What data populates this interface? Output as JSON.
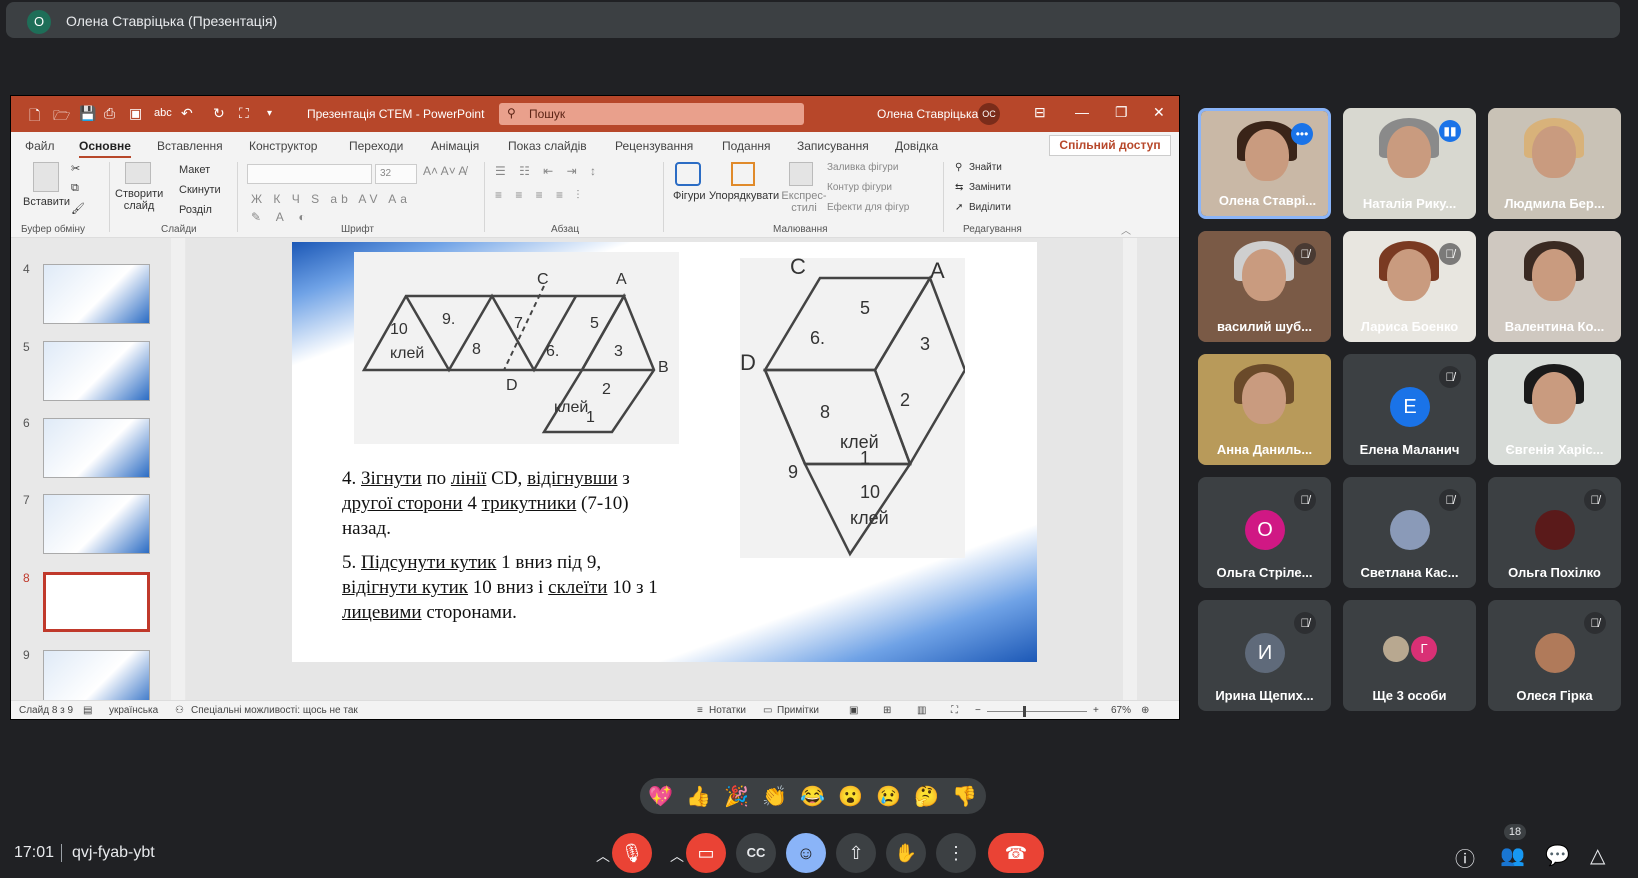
{
  "presenter": {
    "initial": "О",
    "title": "Олена Ставрiцька (Презентацiя)"
  },
  "ppt": {
    "doc_title": "Презентацiя СТЕМ  -  PowerPoint",
    "search_placeholder": "Пошук",
    "user_name": "Олена Ставрiцька",
    "user_initials": "ОС",
    "menu": [
      "Файл",
      "Основне",
      "Вставлення",
      "Конструктор",
      "Переходи",
      "Анiмацiя",
      "Показ слайдiв",
      "Рецензування",
      "Подання",
      "Записування",
      "Довiдка"
    ],
    "share": "Спiльний доступ",
    "ribbon": {
      "paste": "Вставити",
      "clipboard": "Буфер обмiну",
      "new_slide": "Створити слайд",
      "layout": "Макет",
      "reset": "Скинути",
      "section": "Роздiл",
      "slides": "Слайди",
      "font": "Шрифт",
      "font_size": "32",
      "paragraph": "Абзац",
      "shapes": "Фiгури",
      "arrange": "Упорядкувати",
      "quick_styles": "Експрес-стилi",
      "fill": "Заливка фiгури",
      "outline": "Контур фiгури",
      "effects": "Ефекти для фiгур",
      "drawing": "Малювання",
      "find": "Знайти",
      "replace": "Замiнити",
      "select": "Видiлити",
      "editing": "Редагування"
    },
    "thumb_numbers": [
      "4",
      "5",
      "6",
      "7",
      "8",
      "9"
    ],
    "slide": {
      "labels_left": [
        "10",
        "клей",
        "9.",
        "8",
        "7",
        "6.",
        "5",
        "3",
        "2",
        "клей",
        "1",
        "C",
        "A",
        "B",
        "D"
      ],
      "labels_right": [
        "C",
        "A",
        "D",
        "5",
        "6.",
        "3",
        "8",
        "2",
        "клей",
        "1",
        "9",
        "10",
        "клей"
      ],
      "step4": [
        "4. ",
        "Зiгнути",
        " по ",
        "лiнiї",
        " CD, ",
        "вiдiгнувши",
        " з",
        "другої сторони",
        " 4 ",
        "трикутники",
        " (7-10)",
        "назад."
      ],
      "step5": [
        "5. ",
        "Пiдсунути кутик",
        " 1 вниз пiд 9,",
        "вiдiгнути кутик",
        " 10 вниз i ",
        "склеїти",
        " 10 з 1",
        "лицевими",
        " сторонами."
      ]
    },
    "status": {
      "slide_of": "Слайд 8 з 9",
      "language": "українська",
      "accessibility": "Спецiальнi можливостi: щось не так",
      "notes": "Нотатки",
      "comments": "Примiтки",
      "zoom": "67%"
    }
  },
  "participants": [
    {
      "name": "Олена Ставрi...",
      "muted": false,
      "kind": "photo",
      "hair": "#3a2418",
      "bg": "#c9b8a6"
    },
    {
      "name": "Наталiя Рику...",
      "muted": false,
      "kind": "photo",
      "hair": "#8a8a8a",
      "bg": "#d8d8d0"
    },
    {
      "name": "Людмила Бер...",
      "muted": false,
      "kind": "photo",
      "hair": "#d8b27a",
      "bg": "#c9c2b6"
    },
    {
      "name": "василий шуб...",
      "muted": true,
      "kind": "photo",
      "hair": "#cfcfcf",
      "bg": "#7a5a46"
    },
    {
      "name": "Лариса Боенко",
      "muted": true,
      "kind": "photo",
      "hair": "#7a3a22",
      "bg": "#e8e6e0"
    },
    {
      "name": "Валентина Ко...",
      "muted": false,
      "kind": "photo",
      "hair": "#3a2a22",
      "bg": "#cfc8c0"
    },
    {
      "name": "Анна Даниль...",
      "muted": false,
      "kind": "photo",
      "hair": "#6a4a2a",
      "bg": "#b89a5a"
    },
    {
      "name": "Елена Маланич",
      "muted": true,
      "kind": "letter",
      "letter": "Е",
      "color": "#1a73e8"
    },
    {
      "name": "Євгенiя Харiс...",
      "muted": false,
      "kind": "photo",
      "hair": "#1a1a1a",
      "bg": "#d8dcd8"
    },
    {
      "name": "Ольга Стрiле...",
      "muted": true,
      "kind": "letter",
      "letter": "О",
      "color": "#d01884"
    },
    {
      "name": "Светлана Кас...",
      "muted": true,
      "kind": "small",
      "color": "#8a9ab8"
    },
    {
      "name": "Ольга Похiлко",
      "muted": true,
      "kind": "small",
      "color": "#5a1a1a"
    },
    {
      "name": "Ирина Щепих...",
      "muted": true,
      "kind": "letter",
      "letter": "И",
      "color": "#5f6a7a"
    },
    {
      "name": "Ще 3 особи",
      "muted": false,
      "kind": "more",
      "letter": "Г",
      "color": "#d93075"
    },
    {
      "name": "Олеся Гiрка",
      "muted": true,
      "kind": "small",
      "color": "#b07a5a"
    }
  ],
  "reactions": [
    "💖",
    "👍",
    "🎉",
    "👏",
    "😂",
    "😮",
    "😢",
    "🤔",
    "👎"
  ],
  "meeting": {
    "time": "17:01",
    "code": "qvj-fyab-ybt",
    "people_count": "18"
  },
  "icons": [
    "mic-off-icon",
    "camera-off-icon",
    "captions-icon",
    "emoji-icon",
    "present-icon",
    "hand-icon",
    "more-icon",
    "end-call-icon",
    "info-icon",
    "people-icon",
    "chat-icon",
    "activities-icon"
  ],
  "colors": {
    "ppt_accent": "#b7472a",
    "meet_bg": "#202124",
    "end_call": "#ea4335",
    "active_tile": "#8ab4f8"
  }
}
